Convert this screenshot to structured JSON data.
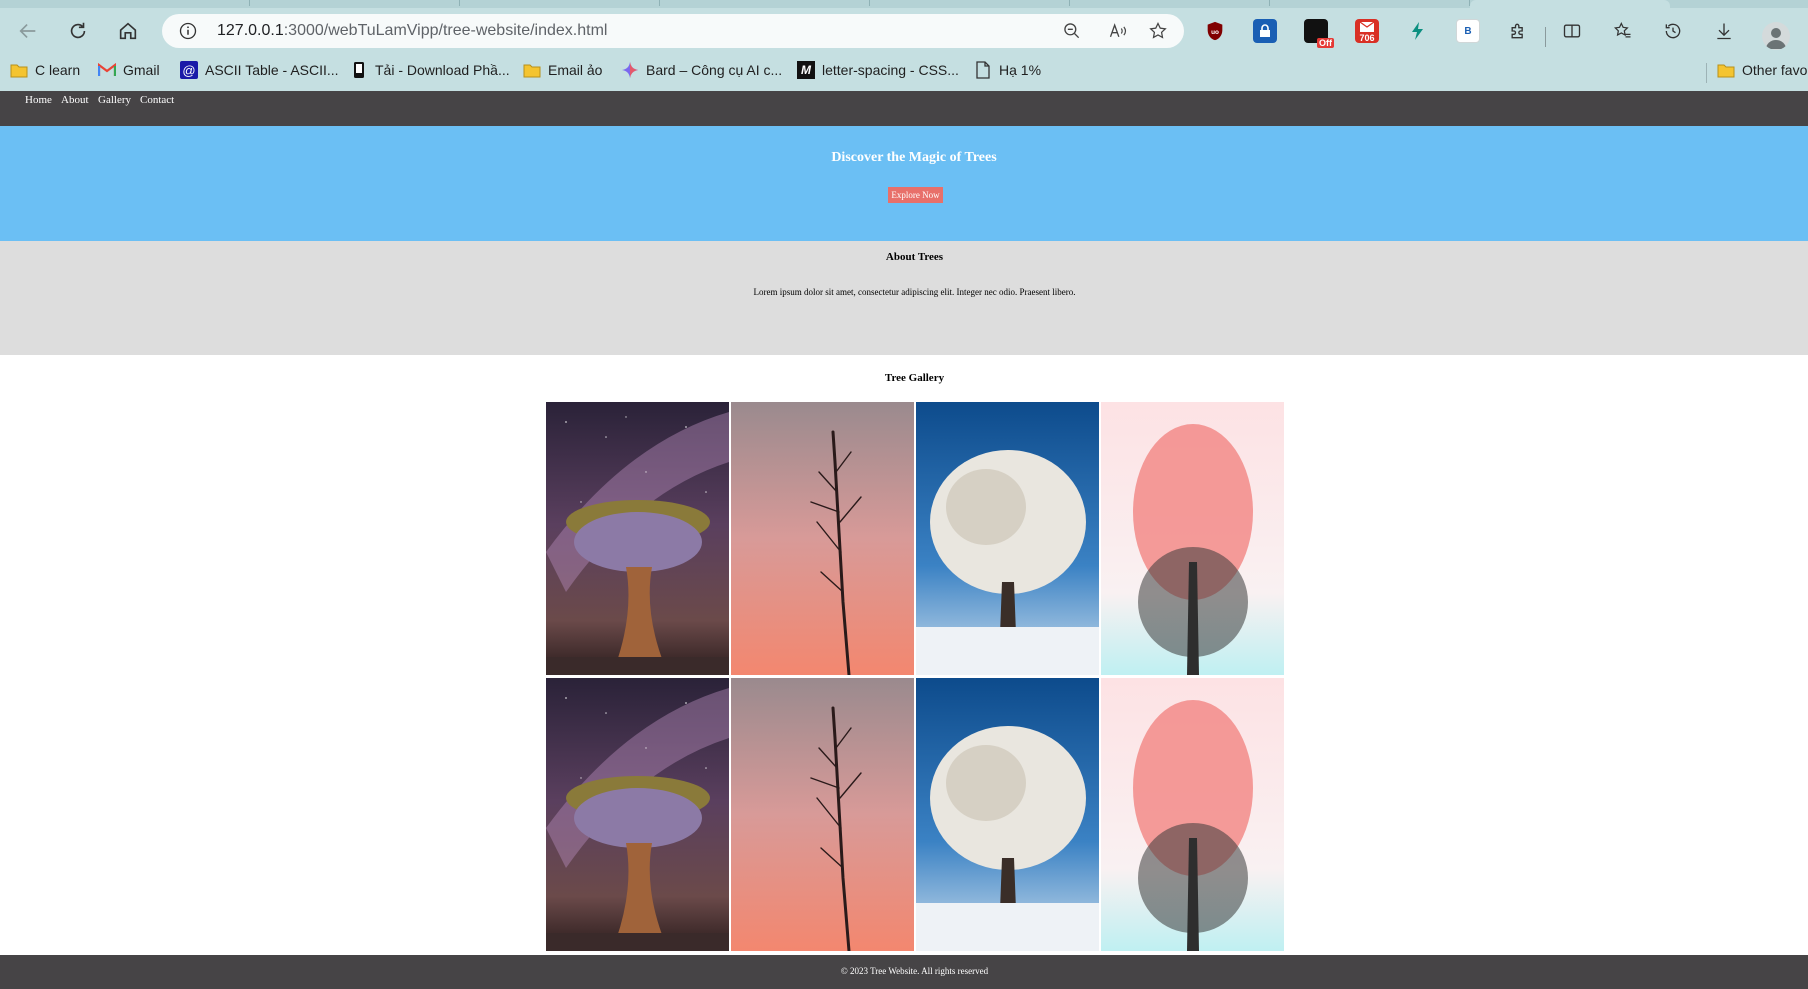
{
  "browser": {
    "address": {
      "host": "127.0.0.1",
      "path": ":3000/webTuLamVipp/tree-website/index.html"
    },
    "extensions": {
      "off_badge": "Off",
      "count_badge": "706",
      "b_badge": "B"
    },
    "bookmarks": [
      {
        "label": "C learn",
        "icon": "folder-icon"
      },
      {
        "label": "Gmail",
        "icon": "gmail-icon"
      },
      {
        "label": "ASCII Table - ASCII...",
        "icon": "at-icon"
      },
      {
        "label": "Tải - Download Phầ...",
        "icon": "phone-icon"
      },
      {
        "label": "Email ảo",
        "icon": "folder-icon"
      },
      {
        "label": "Bard – Công cụ AI c...",
        "icon": "bard-icon"
      },
      {
        "label": "letter-spacing - CSS...",
        "icon": "mdn-icon"
      },
      {
        "label": "Hạ 1%",
        "icon": "page-icon"
      }
    ],
    "other_favorites": "Other favo"
  },
  "site": {
    "nav": [
      "Home",
      "About",
      "Gallery",
      "Contact"
    ],
    "hero": {
      "title": "Discover the Magic of Trees",
      "button": "Explore Now"
    },
    "about": {
      "title": "About Trees",
      "text": "Lorem ipsum dolor sit amet, consectetur adipiscing elit. Integer nec odio. Praesent libero."
    },
    "gallery": {
      "title": "Tree Gallery",
      "images": [
        "quiver-tree-milky-way",
        "bare-tree-pink-sky",
        "frosted-tree-winter",
        "pink-tree-mist",
        "quiver-tree-milky-way",
        "bare-tree-pink-sky",
        "frosted-tree-winter",
        "pink-tree-mist"
      ]
    },
    "footer": "© 2023 Tree Website. All rights reserved"
  },
  "colors": {
    "chrome": "#c5dfe1",
    "nav_bg": "#464446",
    "hero_bg": "#6bbff4",
    "hero_button": "#e8706a",
    "about_bg": "#dddddd"
  }
}
